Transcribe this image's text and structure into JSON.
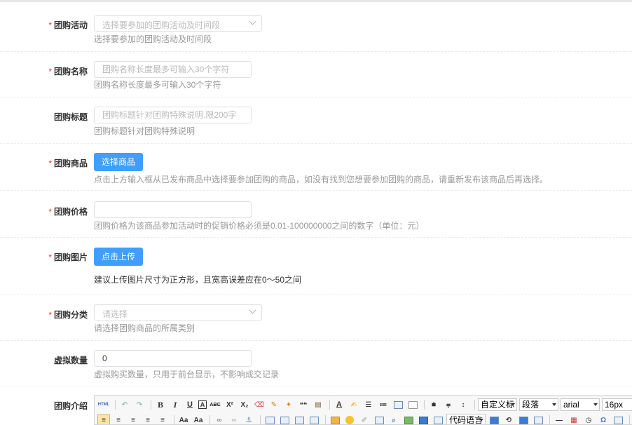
{
  "form": {
    "activity": {
      "required": "*",
      "label": "团购活动",
      "placeholder": "选择要参加的团购活动及时间段",
      "hint": "选择要参加的团购活动及时间段"
    },
    "name": {
      "required": "*",
      "label": "团购名称",
      "placeholder": "团购名称长度最多可输入30个字符",
      "hint": "团购名称长度最多可输入30个字符"
    },
    "title": {
      "label": "团购标题",
      "placeholder": "团购标题针对团购特殊说明,限200字",
      "hint": "团购标题针对团购特殊说明"
    },
    "goods": {
      "required": "*",
      "label": "团购商品",
      "button": "选择商品",
      "hint": "点击上方输入框从已发布商品中选择要参加团购的商品，如没有找到您想要参加团购的商品，请重新发布该商品后再选择。"
    },
    "price": {
      "required": "*",
      "label": "团购价格",
      "value": "",
      "hint": "团购价格为该商品参加活动时的促销价格必须是0.01-100000000之间的数字（单位：元）"
    },
    "image": {
      "required": "*",
      "label": "团购图片",
      "button": "点击上传",
      "hint": "建议上传图片尺寸为正方形，且宽高误差应在0～50之间"
    },
    "category": {
      "required": "*",
      "label": "团购分类",
      "placeholder": "请选择",
      "hint": "请选择团购商品的所属类别"
    },
    "virtual": {
      "label": "虚拟数量",
      "value": "0",
      "hint": "虚拟购买数量，只用于前台显示，不影响成交记录"
    },
    "intro": {
      "label": "团购介绍"
    }
  },
  "editor": {
    "html_label": "HTML",
    "custom_style": "自定义标",
    "paragraph": "段落",
    "font_family": "arial",
    "font_size": "16px",
    "code_lang": "代码语言",
    "icons_row1": [
      "html-icon",
      "undo-icon",
      "redo-icon",
      "bold-icon",
      "italic-icon",
      "underline-icon",
      "font-border-icon",
      "strikethrough-icon",
      "superscript-icon",
      "subscript-icon",
      "eraser-icon",
      "format-brush-icon",
      "auto-format-icon",
      "blockquote-icon",
      "paste-plain-icon",
      "font-color-icon",
      "highlight-color-icon",
      "ordered-list-icon",
      "unordered-list-icon",
      "select-all-icon",
      "clear-doc-icon",
      "row-spacing-top-icon",
      "row-spacing-bottom-icon",
      "line-height-icon"
    ],
    "glyphs": {
      "bold": "B",
      "italic": "I",
      "underline": "U",
      "font_border": "A",
      "strike": "ABC",
      "sup": "X²",
      "sub": "X₂",
      "quote": "❝❝",
      "font_color": "A",
      "html": "HTML"
    }
  }
}
